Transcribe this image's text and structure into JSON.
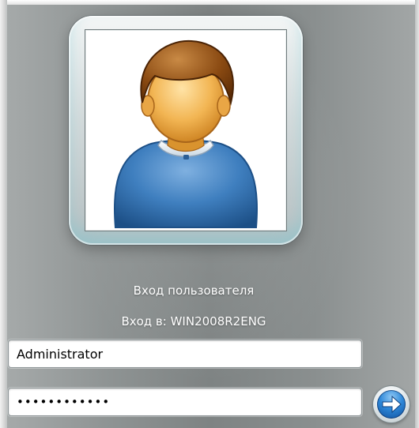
{
  "screen": {
    "title": "Вход пользователя",
    "domain_line": "Вход в: WIN2008R2ENG"
  },
  "user_field": {
    "value": "Administrator"
  },
  "password_field": {
    "value": "••••••••••••"
  },
  "avatar": {
    "icon": "user-avatar-icon"
  },
  "go_button": {
    "icon": "arrow-right-icon"
  },
  "colors": {
    "background": "#878c8c",
    "arrow_blue": "#2d87d8",
    "shirt_blue": "#3f7fbf",
    "hair_brown": "#8a4a12",
    "skin": "#f2b553"
  }
}
